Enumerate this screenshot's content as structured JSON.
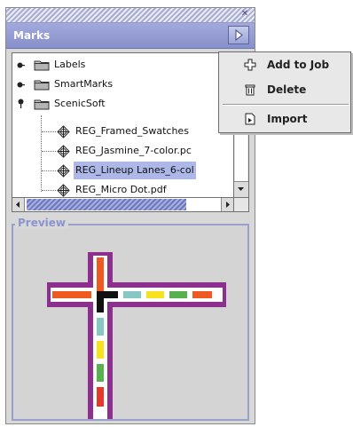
{
  "panel": {
    "title": "Marks"
  },
  "tree": {
    "folders": [
      {
        "label": "Labels",
        "expanded": false
      },
      {
        "label": "SmartMarks",
        "expanded": false
      },
      {
        "label": "ScenicSoft",
        "expanded": true
      }
    ],
    "files": [
      {
        "label": "REG_Framed_Swatches",
        "selected": false
      },
      {
        "label": "REG_Jasmine_7-color.pc",
        "selected": false
      },
      {
        "label": "REG_Lineup Lanes_6-col",
        "selected": true
      },
      {
        "label": "REG_Micro Dot.pdf",
        "selected": false
      }
    ]
  },
  "preview": {
    "label": "Preview"
  },
  "popup_menu": {
    "items": [
      {
        "label": "Add to Job",
        "icon": "add-to-job-icon"
      },
      {
        "label": "Delete",
        "icon": "trash-icon"
      },
      {
        "label": "Import",
        "icon": "import-icon"
      }
    ]
  },
  "colors": {
    "header": "#8f97d2",
    "selection": "#aeb8e8",
    "preview_border": "#9aa0cc",
    "mark_purple": "#8c2f8e",
    "mark_orange": "#ef5a23",
    "mark_red": "#e53a2a",
    "mark_cyan": "#86c9c4",
    "mark_yellow": "#f7e21b",
    "mark_green": "#57b24e",
    "mark_black": "#111111"
  }
}
